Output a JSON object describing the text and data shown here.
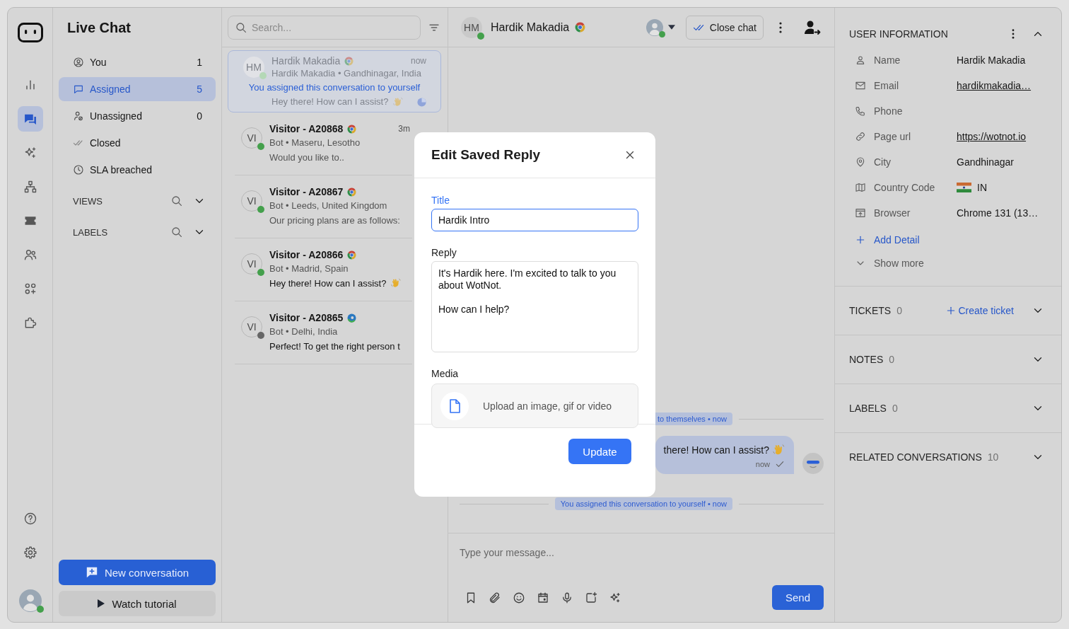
{
  "nav_rail": {
    "items": [
      {
        "selected": false
      },
      {
        "selected": true
      },
      {
        "selected": false
      },
      {
        "selected": false
      },
      {
        "selected": false
      },
      {
        "selected": false
      },
      {
        "selected": false
      },
      {
        "selected": false
      }
    ],
    "account": {
      "online": true
    }
  },
  "sidebar": {
    "title": "Live Chat",
    "items": [
      {
        "label": "You",
        "count": "1",
        "selected": false
      },
      {
        "label": "Assigned",
        "count": "5",
        "selected": true
      },
      {
        "label": "Unassigned",
        "count": "0",
        "selected": false
      },
      {
        "label": "Closed",
        "selected": false
      },
      {
        "label": "SLA breached",
        "selected": false
      }
    ],
    "sections": [
      {
        "label": "VIEWS",
        "expanded": false
      },
      {
        "label": "LABELS",
        "expanded": false
      }
    ],
    "new_conversation": "New conversation",
    "watch_tutorial": "Watch tutorial"
  },
  "conversation_list": {
    "search": {
      "placeholder": "Search..."
    },
    "conversations": [
      {
        "avatar": "HM",
        "name": "Hardik Makadia",
        "browser": {
          "kind": "chrome"
        },
        "subtitle": "Hardik Makadia • Gandhinagar, India",
        "preview": "Hey there! How can I assist?",
        "trailing_emoji": true,
        "time": "now",
        "color": "#b4d8b6",
        "unread": false,
        "sla_timer": true,
        "selected": true,
        "notice": "You assigned this conversation to yourself"
      },
      {
        "avatar": "VI",
        "name": "Visitor - A20868",
        "browser": {
          "kind": "chrome"
        },
        "subtitle": "Bot • Maseru, Lesotho",
        "preview": "Would you like to..",
        "trailing_emoji": false,
        "time": "3m",
        "color": "#44a04c",
        "unread": false,
        "sla_timer": false,
        "selected": false
      },
      {
        "avatar": "VI",
        "name": "Visitor - A20867",
        "browser": {
          "kind": "chrome"
        },
        "subtitle": "Bot • Leeds, United Kingdom",
        "preview": "Our pricing plans are as follows:",
        "trailing_emoji": false,
        "color": "#44a04c",
        "unread": false,
        "sla_timer": false,
        "selected": false
      },
      {
        "avatar": "VI",
        "name": "Visitor - A20866",
        "browser": {
          "kind": "chrome"
        },
        "subtitle": "Bot • Madrid, Spain",
        "preview": "Hey there! How can I assist?",
        "trailing_emoji": true,
        "color": "#44a04c",
        "unread": true,
        "sla_timer": false,
        "selected": false
      },
      {
        "avatar": "VI",
        "name": "Visitor - A20865",
        "browser": {
          "kind": "edge"
        },
        "subtitle": "Bot • Delhi, India",
        "preview": "Perfect! To get the right person t",
        "trailing_emoji": false,
        "color": "#666666",
        "unread": true,
        "sla_timer": false,
        "selected": false
      }
    ]
  },
  "chat": {
    "contact": {
      "avatar": "HM",
      "name": "Hardik Makadia",
      "browser": {
        "kind": "chrome"
      },
      "online": true
    },
    "assignee": {
      "online": true
    },
    "close_button": "Close chat",
    "messages": [
      {
        "kind": "system",
        "text": "to themselves • now"
      },
      {
        "kind": "bubble",
        "text": "there! How can I assist?",
        "trailing_emoji": true,
        "time": "now",
        "delivered": true
      },
      {
        "kind": "system",
        "text": "You assigned this conversation to yourself • now"
      }
    ],
    "composer": {
      "placeholder": "Type your message...",
      "send": "Send"
    }
  },
  "user_panel": {
    "title": "USER INFORMATION",
    "expanded": true,
    "fields": [
      {
        "kind": "text",
        "label": "Name",
        "value": "Hardik Makadia"
      },
      {
        "kind": "link",
        "label": "Email",
        "value": "hardikmakadia…"
      },
      {
        "kind": "text",
        "label": "Phone"
      },
      {
        "kind": "link",
        "label": "Page url",
        "value": "https://wotnot.io"
      },
      {
        "kind": "text",
        "label": "City",
        "value": "Gandhinagar"
      },
      {
        "kind": "country",
        "label": "Country Code",
        "value": "IN"
      },
      {
        "kind": "text",
        "label": "Browser",
        "value": "Chrome 131 (13…"
      }
    ],
    "add_detail": "Add Detail",
    "show_more": "Show more",
    "sections": [
      {
        "title": "TICKETS",
        "count": "0",
        "action": "Create ticket",
        "expanded": false
      },
      {
        "title": "NOTES",
        "count": "0",
        "expanded": false
      },
      {
        "title": "LABELS",
        "count": "0",
        "expanded": false
      },
      {
        "title": "RELATED CONVERSATIONS",
        "count": "10",
        "expanded": false
      }
    ]
  },
  "modal": {
    "title": "Edit Saved Reply",
    "fields": [
      {
        "kind": "input",
        "label": "Title",
        "value": "Hardik Intro",
        "focused": true
      },
      {
        "kind": "textarea",
        "label": "Reply",
        "value": "It's Hardik here. I'm excited to talk to you about WotNot.\n\nHow can I help?",
        "focused": false
      },
      {
        "kind": "upload",
        "label": "Media",
        "placeholder": "Upload an image, gif or video"
      }
    ],
    "button": "Update"
  }
}
